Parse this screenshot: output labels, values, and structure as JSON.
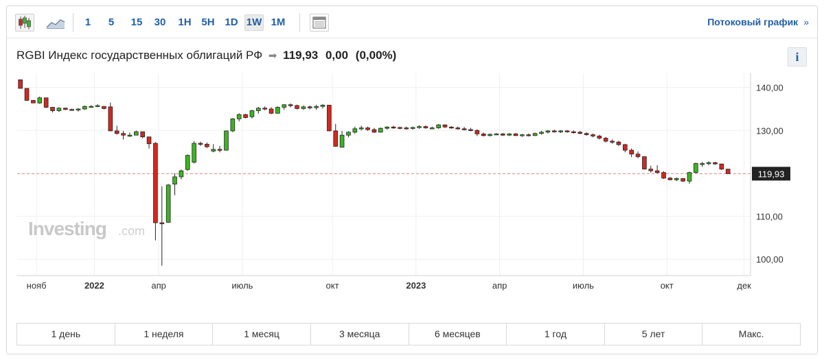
{
  "toolbar": {
    "intervals": [
      "1",
      "5",
      "15",
      "30",
      "1H",
      "5H",
      "1D",
      "1W",
      "1M"
    ],
    "active_interval": "1W",
    "stream_link": "Потоковый график",
    "stream_chevron": "»"
  },
  "header": {
    "instrument": "RGBI Индекс государственных облигаций РФ",
    "price": "119,93",
    "change": "0,00",
    "change_pct": "(0,00%)",
    "info_label": "i"
  },
  "colors": {
    "up": "#3cb521",
    "down": "#d4281f",
    "last_price_bg": "#222222",
    "link": "#1f5ea8"
  },
  "watermark": {
    "brand": "Investing",
    "suffix": ".com"
  },
  "ranges": [
    "1 день",
    "1 неделя",
    "1 месяц",
    "3 месяца",
    "6 месяцев",
    "1 год",
    "5 лет",
    "Макс."
  ],
  "chart_data": {
    "type": "candlestick",
    "ylim": [
      96.2,
      143.3
    ],
    "y_ticks": [
      {
        "v": 140,
        "label": "140,00"
      },
      {
        "v": 130,
        "label": "130,00"
      },
      {
        "v": 120,
        "label": "120,00"
      },
      {
        "v": 110,
        "label": "110,00"
      },
      {
        "v": 100,
        "label": "100,00"
      }
    ],
    "last_price": {
      "value": 119.93,
      "label": "119,93"
    },
    "x_range": [
      0,
      114
    ],
    "x_ticks": [
      {
        "i": 2.5,
        "label": "нояб",
        "bold": false
      },
      {
        "i": 11.5,
        "label": "2022",
        "bold": true
      },
      {
        "i": 21.5,
        "label": "апр",
        "bold": false
      },
      {
        "i": 34.5,
        "label": "июль",
        "bold": false
      },
      {
        "i": 48.5,
        "label": "окт",
        "bold": false
      },
      {
        "i": 61.5,
        "label": "2023",
        "bold": true
      },
      {
        "i": 74.5,
        "label": "апр",
        "bold": false
      },
      {
        "i": 87.5,
        "label": "июль",
        "bold": false
      },
      {
        "i": 100.5,
        "label": "окт",
        "bold": false
      },
      {
        "i": 112.5,
        "label": "дек",
        "bold": false
      }
    ],
    "candles": [
      [
        141.8,
        141.8,
        139.8,
        139.8
      ],
      [
        139.8,
        139.8,
        137.0,
        137.0
      ],
      [
        137.0,
        137.0,
        136.4,
        136.4
      ],
      [
        136.4,
        137.9,
        136.2,
        137.6
      ],
      [
        137.6,
        137.6,
        135.2,
        135.4
      ],
      [
        135.4,
        135.4,
        134.2,
        134.6
      ],
      [
        134.6,
        135.4,
        134.3,
        135.2
      ],
      [
        135.2,
        135.3,
        134.7,
        134.9
      ],
      [
        134.9,
        135.1,
        134.6,
        134.8
      ],
      [
        134.8,
        135.2,
        134.4,
        135.0
      ],
      [
        135.0,
        135.8,
        134.8,
        135.6
      ],
      [
        135.6,
        135.9,
        135.3,
        135.6
      ],
      [
        135.6,
        136.1,
        135.4,
        135.8
      ],
      [
        135.6,
        135.6,
        134.9,
        135.1
      ],
      [
        135.5,
        136.5,
        129.8,
        129.9
      ],
      [
        129.9,
        131.1,
        129.0,
        129.3
      ],
      [
        129.3,
        129.9,
        127.9,
        128.9
      ],
      [
        128.9,
        129.5,
        128.5,
        128.9
      ],
      [
        128.9,
        130.0,
        128.9,
        129.7
      ],
      [
        129.7,
        129.7,
        128.2,
        128.5
      ],
      [
        128.5,
        128.5,
        125.8,
        126.9
      ],
      [
        127.0,
        127.3,
        104.4,
        108.5
      ],
      [
        108.5,
        117.0,
        98.5,
        108.4
      ],
      [
        108.6,
        117.5,
        108.5,
        117.3
      ],
      [
        117.5,
        120.0,
        114.9,
        119.2
      ],
      [
        119.2,
        120.9,
        118.6,
        120.6
      ],
      [
        120.9,
        124.4,
        120.6,
        124.2
      ],
      [
        122.6,
        127.5,
        122.3,
        127.0
      ],
      [
        127.0,
        127.4,
        126.4,
        126.8
      ],
      [
        126.8,
        127.2,
        125.9,
        126.2
      ],
      [
        125.2,
        126.8,
        124.9,
        125.6
      ],
      [
        125.6,
        126.4,
        124.9,
        125.4
      ],
      [
        125.4,
        129.9,
        125.3,
        129.9
      ],
      [
        129.9,
        132.9,
        129.6,
        132.7
      ],
      [
        132.7,
        134.0,
        132.1,
        133.7
      ],
      [
        133.7,
        133.9,
        132.8,
        133.0
      ],
      [
        133.2,
        134.8,
        132.8,
        134.6
      ],
      [
        134.6,
        135.5,
        133.9,
        135.2
      ],
      [
        135.2,
        135.6,
        134.7,
        135.0
      ],
      [
        135.0,
        135.4,
        133.8,
        134.0
      ],
      [
        134.0,
        135.6,
        133.9,
        135.4
      ],
      [
        135.4,
        136.1,
        134.8,
        136.0
      ],
      [
        136.0,
        136.3,
        135.4,
        135.8
      ],
      [
        135.8,
        136.0,
        134.9,
        135.1
      ],
      [
        135.1,
        135.8,
        134.8,
        135.5
      ],
      [
        135.5,
        135.8,
        134.9,
        135.3
      ],
      [
        135.3,
        136.0,
        134.8,
        135.6
      ],
      [
        135.6,
        136.1,
        135.1,
        135.9
      ],
      [
        135.9,
        135.9,
        129.8,
        129.9
      ],
      [
        129.9,
        131.5,
        126.2,
        126.3
      ],
      [
        126.1,
        129.9,
        126.0,
        128.9
      ],
      [
        128.9,
        129.8,
        128.4,
        129.6
      ],
      [
        129.6,
        130.9,
        129.2,
        130.4
      ],
      [
        130.4,
        131.1,
        130.0,
        130.6
      ],
      [
        130.6,
        130.9,
        129.9,
        130.2
      ],
      [
        130.2,
        130.6,
        129.4,
        129.6
      ],
      [
        129.6,
        130.7,
        129.5,
        130.5
      ],
      [
        130.5,
        131.0,
        130.2,
        130.8
      ],
      [
        130.8,
        131.1,
        130.4,
        130.7
      ],
      [
        130.7,
        130.9,
        130.3,
        130.6
      ],
      [
        130.6,
        130.9,
        130.2,
        130.5
      ],
      [
        130.5,
        130.9,
        130.2,
        130.7
      ],
      [
        130.7,
        131.2,
        130.4,
        130.9
      ],
      [
        130.9,
        131.2,
        130.4,
        130.6
      ],
      [
        130.6,
        130.9,
        130.3,
        130.6
      ],
      [
        130.6,
        131.5,
        130.4,
        131.3
      ],
      [
        131.3,
        131.4,
        130.6,
        130.8
      ],
      [
        130.8,
        131.0,
        130.4,
        130.6
      ],
      [
        130.6,
        130.9,
        130.2,
        130.4
      ],
      [
        130.4,
        130.8,
        130.0,
        130.2
      ],
      [
        130.2,
        130.6,
        129.8,
        130.0
      ],
      [
        130.0,
        130.3,
        128.7,
        129.2
      ],
      [
        129.2,
        129.5,
        128.6,
        128.8
      ],
      [
        128.8,
        129.3,
        128.6,
        129.1
      ],
      [
        129.1,
        129.4,
        128.9,
        129.2
      ],
      [
        129.2,
        129.4,
        128.7,
        128.9
      ],
      [
        128.9,
        129.4,
        128.7,
        129.2
      ],
      [
        129.2,
        129.4,
        128.7,
        128.8
      ],
      [
        128.8,
        129.2,
        128.5,
        129.0
      ],
      [
        129.0,
        129.3,
        128.6,
        128.8
      ],
      [
        128.8,
        129.5,
        128.7,
        129.3
      ],
      [
        129.3,
        129.9,
        129.0,
        129.6
      ],
      [
        129.6,
        130.1,
        129.3,
        129.9
      ],
      [
        129.9,
        130.2,
        129.5,
        129.8
      ],
      [
        129.8,
        130.1,
        129.4,
        129.9
      ],
      [
        129.9,
        130.1,
        129.5,
        129.7
      ],
      [
        129.7,
        130.0,
        129.3,
        129.6
      ],
      [
        129.6,
        129.9,
        129.1,
        129.3
      ],
      [
        129.3,
        129.6,
        128.8,
        129.0
      ],
      [
        129.0,
        129.3,
        128.4,
        128.7
      ],
      [
        128.7,
        129.0,
        127.9,
        128.2
      ],
      [
        128.2,
        128.5,
        127.2,
        127.5
      ],
      [
        127.5,
        127.9,
        126.9,
        127.3
      ],
      [
        127.3,
        127.6,
        126.4,
        126.7
      ],
      [
        126.7,
        126.9,
        124.9,
        125.4
      ],
      [
        125.4,
        125.8,
        123.8,
        124.5
      ],
      [
        124.5,
        125.1,
        123.5,
        123.9
      ],
      [
        123.9,
        123.9,
        120.9,
        121.0
      ],
      [
        121.0,
        121.8,
        120.2,
        120.6
      ],
      [
        120.6,
        121.9,
        120.0,
        120.2
      ],
      [
        120.2,
        120.5,
        118.7,
        118.9
      ],
      [
        118.9,
        119.2,
        118.4,
        118.5
      ],
      [
        118.5,
        119.1,
        118.2,
        118.8
      ],
      [
        118.8,
        118.9,
        118.0,
        118.2
      ],
      [
        118.2,
        120.4,
        117.6,
        120.2
      ],
      [
        120.2,
        122.5,
        120.0,
        122.3
      ],
      [
        122.3,
        122.7,
        121.5,
        122.3
      ],
      [
        122.3,
        122.8,
        121.9,
        122.5
      ],
      [
        122.5,
        122.7,
        122.0,
        122.2
      ],
      [
        122.2,
        122.2,
        120.8,
        121.0
      ],
      [
        121.0,
        121.0,
        119.9,
        119.93
      ]
    ]
  }
}
